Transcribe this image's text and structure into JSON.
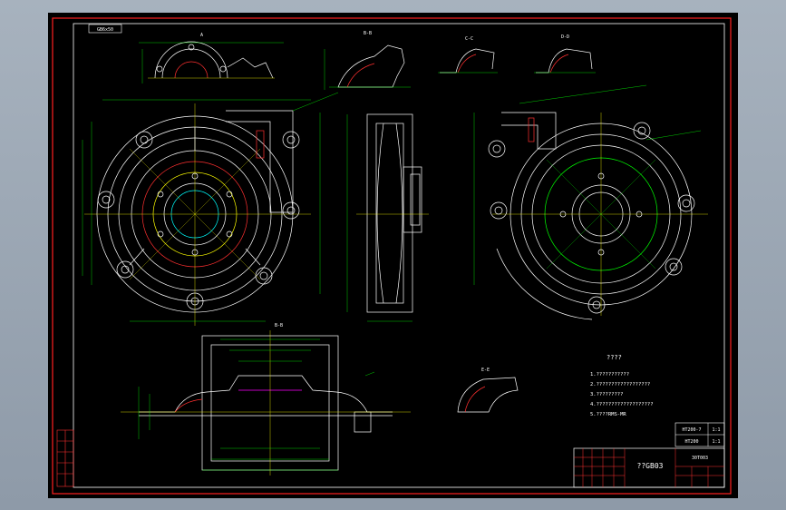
{
  "titleblock": {
    "stamp": "GB6x50",
    "drawing_title": "??GB03",
    "mat1": "HT200-7",
    "mat2": "HT200",
    "qty1": "1:1",
    "qty2": "1:1",
    "scale_code": "30T003"
  },
  "notes": {
    "heading": "????",
    "lines": [
      "1.???????????",
      "2.??????????????????",
      "3.?????????",
      "4.???????????????????",
      "5.????RMS-MR"
    ]
  },
  "section_labels": {
    "top_left_view": "A",
    "top_middle_view": "B-B",
    "top_right_view_a": "C-C",
    "top_right_view_b": "D-D",
    "bottom_view": "B-B",
    "detail_view": "E-E"
  },
  "colors": {
    "background": "#000000",
    "frame": "#ff0000",
    "lines": "#ffffff",
    "dimensions": "#00ff00",
    "hidden": "#ff00ff",
    "center": "#ffff00"
  }
}
